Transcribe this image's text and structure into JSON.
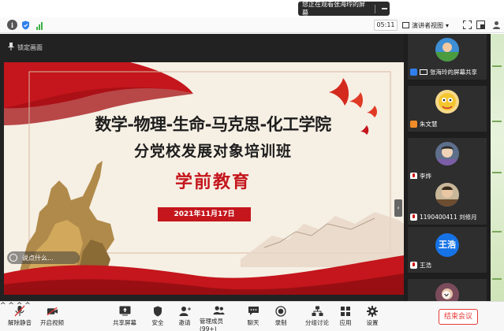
{
  "banner": {
    "text": "您正在观看张海玲的屏幕"
  },
  "topbar": {
    "timer": "05:11",
    "view_label": "演讲者视图"
  },
  "slide": {
    "lock_label": "锁定画面",
    "title_line1": "数学-物理-生命-马克思-化工学院",
    "title_line2": "分党校发展对象培训班",
    "title_line3": "学前教育",
    "date": "2021年11月17日",
    "chat_placeholder": "说点什么..."
  },
  "participants": [
    {
      "name": "张海玲的屏幕共享"
    },
    {
      "name": "朱文慧"
    },
    {
      "name": "李烨"
    },
    {
      "name": "1190400411 刘修月"
    },
    {
      "name": "王浩",
      "avatar_text": "王浩"
    }
  ],
  "bottombar": {
    "mute": "解除静音",
    "video": "开启视频",
    "share": "共享屏幕",
    "security": "安全",
    "invite": "邀请",
    "members": "管理成员(99+)",
    "chat": "聊天",
    "record": "录制",
    "breakout": "分组讨论",
    "apps": "应用",
    "settings": "设置",
    "end": "结束会议"
  },
  "colors": {
    "accent_red": "#c4161c",
    "host_blue": "#1673e6",
    "end_red": "#e53935"
  }
}
